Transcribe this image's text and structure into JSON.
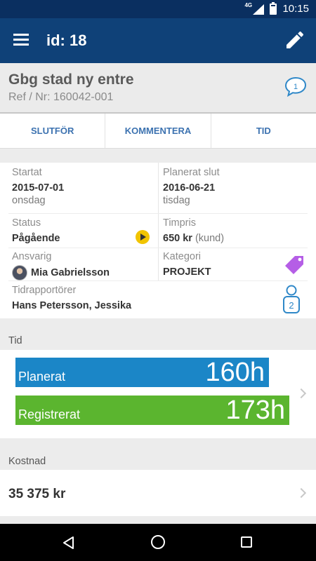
{
  "status_bar": {
    "network": "4G",
    "time": "10:15"
  },
  "app_bar": {
    "title": "id: 18",
    "menu_icon": "menu-icon",
    "edit_icon": "pencil-icon"
  },
  "header": {
    "title": "Gbg stad ny entre",
    "ref": "Ref / Nr: 160042-001",
    "comment_count": "1"
  },
  "actions": [
    "SLUTFÖR",
    "KOMMENTERA",
    "TID"
  ],
  "info": {
    "startat": {
      "label": "Startat",
      "date": "2015-07-01",
      "day": "onsdag"
    },
    "planerat_slut": {
      "label": "Planerat slut",
      "date": "2016-06-21",
      "day": "tisdag"
    },
    "status": {
      "label": "Status",
      "value": "Pågående"
    },
    "timpris": {
      "label": "Timpris",
      "value": "650 kr",
      "suffix": "(kund)"
    },
    "ansvarig": {
      "label": "Ansvarig",
      "value": "Mia  Gabrielsson"
    },
    "kategori": {
      "label": "Kategori",
      "value": "PROJEKT",
      "tag_color": "#b55ee6"
    },
    "tidrapportorer": {
      "label": "Tidrapportörer",
      "value": "Hans Petersson, Jessika",
      "count": "2"
    }
  },
  "tid": {
    "section_label": "Tid",
    "planerat": {
      "label": "Planerat",
      "hours": "160h",
      "value": 160,
      "color": "#1b86c7"
    },
    "registrerat": {
      "label": "Registrerat",
      "hours": "173h",
      "value": 173,
      "color": "#5bb52f"
    }
  },
  "kostnad": {
    "section_label": "Kostnad",
    "value": "35 375 kr"
  },
  "colors": {
    "status_bar": "#0a2f60",
    "app_bar": "#0f4178",
    "accent": "#3c72b0",
    "status_dot": "#f1c400"
  }
}
